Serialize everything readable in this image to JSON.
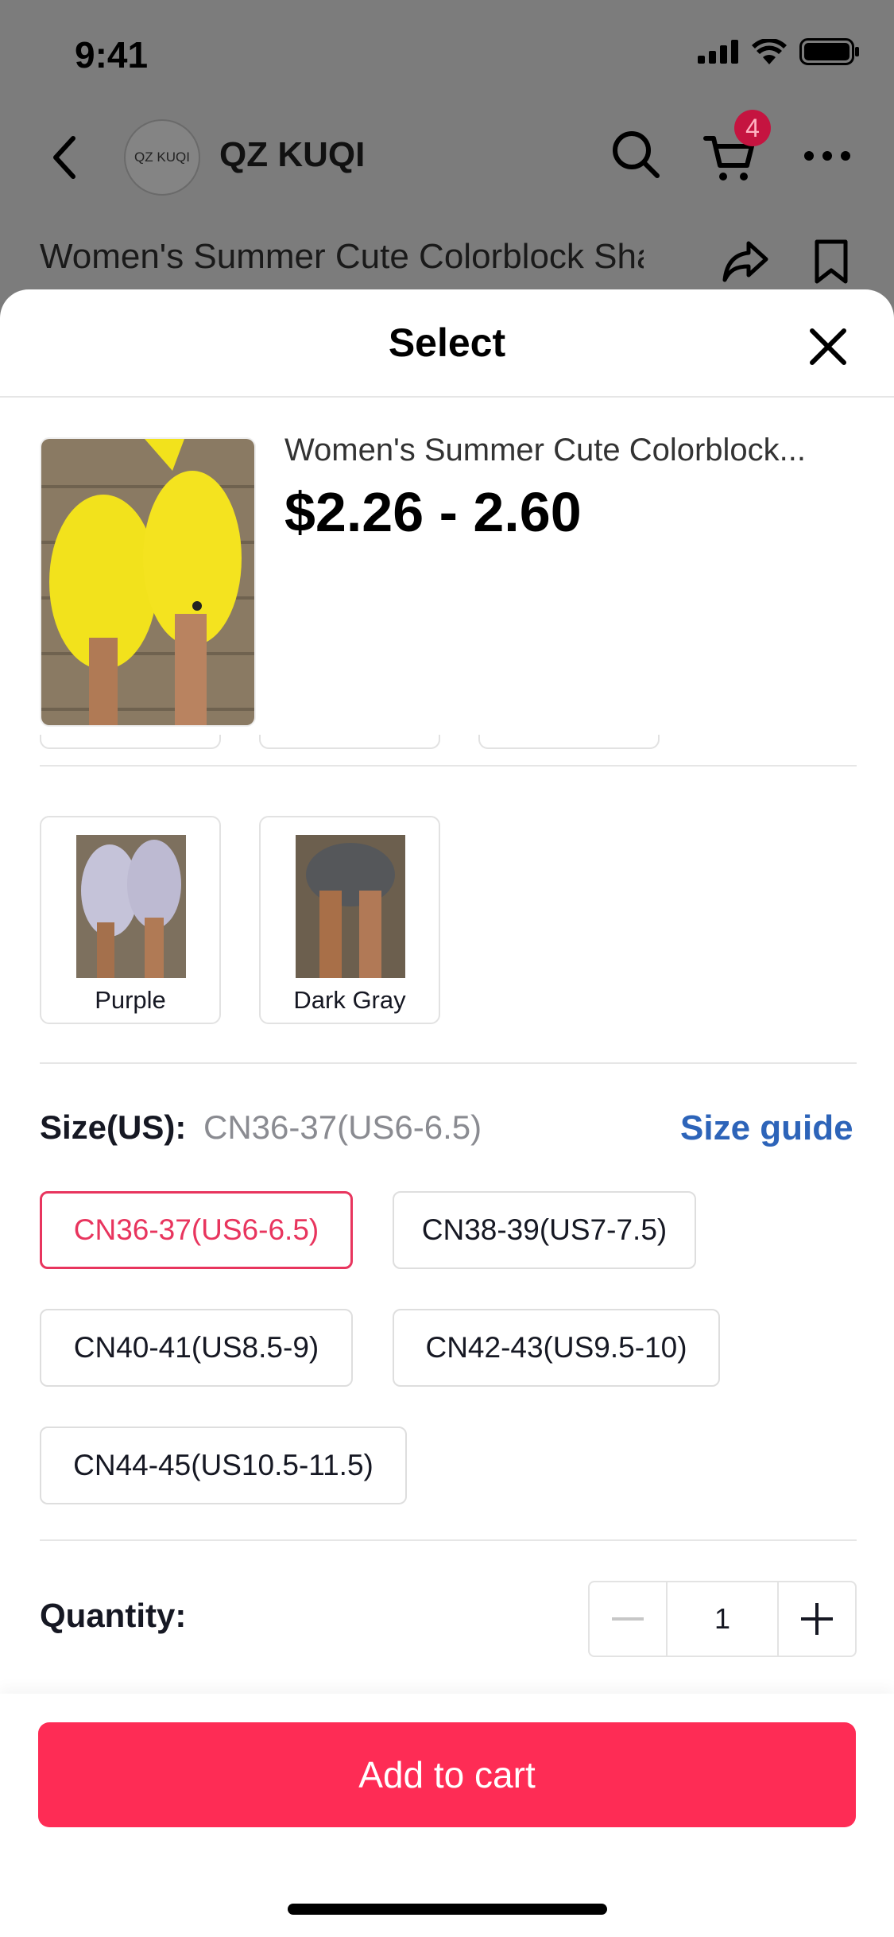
{
  "status_bar": {
    "time": "9:41"
  },
  "shop": {
    "logo_text": "QZ KUQI",
    "name": "QZ KUQI",
    "cart_count": "4"
  },
  "background": {
    "product_title": "Women's Summer Cute Colorblock Shark Design Slippers, Shower S"
  },
  "sheet": {
    "title": "Select"
  },
  "product": {
    "name": "Women's Summer Cute Colorblock...",
    "price": "$2.26 - 2.60"
  },
  "variants": [
    {
      "label": "Purple",
      "color": "#b9b7cf"
    },
    {
      "label": "Dark Gray",
      "color": "#5d5f5e"
    }
  ],
  "size": {
    "label": "Size(US):",
    "selected_value": "CN36-37(US6-6.5)",
    "guide_label": "Size guide",
    "options": [
      "CN36-37(US6-6.5)",
      "CN38-39(US7-7.5)",
      "CN40-41(US8.5-9)",
      "CN42-43(US9.5-10)",
      "CN44-45(US10.5-11.5)"
    ]
  },
  "quantity": {
    "label": "Quantity:",
    "value": "1"
  },
  "cta": {
    "label": "Add to cart"
  },
  "colors": {
    "accent": "#fe2c55",
    "link": "#2d64b9",
    "badge": "#c51440"
  }
}
